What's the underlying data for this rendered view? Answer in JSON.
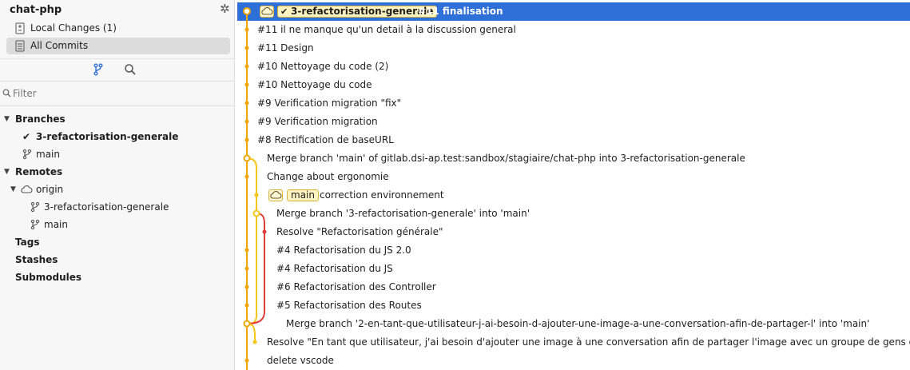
{
  "app": {
    "repo_name": "chat-php"
  },
  "views": {
    "local_changes": "Local Changes (1)",
    "all_commits": "All Commits"
  },
  "filter": {
    "placeholder": "Filter"
  },
  "tree": {
    "branches_header": "Branches",
    "branches": [
      "3-refactorisation-generale",
      "main"
    ],
    "remotes_header": "Remotes",
    "remote_name": "origin",
    "remote_branches": [
      "3-refactorisation-generale",
      "main"
    ],
    "tags_header": "Tags",
    "stashes_header": "Stashes",
    "submodules_header": "Submodules"
  },
  "colors": {
    "selection": "#2f6fd8",
    "graph_orange": "#f0a500",
    "graph_yellow": "#f5c518",
    "graph_red": "#e03c3c"
  },
  "commits": [
    {
      "message": "#11 finalisation",
      "branch_ref": "3-refactorisation-generale",
      "selected": true
    },
    {
      "message": "#11 il ne manque qu'un detail à la discussion general"
    },
    {
      "message": "#11 Design"
    },
    {
      "message": "#10 Nettoyage du code (2)"
    },
    {
      "message": "#10 Nettoyage du code"
    },
    {
      "message": "#9 Verification migration \"fix\""
    },
    {
      "message": "#9 Verification migration"
    },
    {
      "message": "#8 Rectification de baseURL"
    },
    {
      "message": "Merge branch 'main' of gitlab.dsi-ap.test:sandbox/stagiaire/chat-php into 3-refactorisation-generale"
    },
    {
      "message": "Change about ergonomie"
    },
    {
      "message": "correction environnement",
      "branch_ref": "main"
    },
    {
      "message": "Merge branch '3-refactorisation-generale' into 'main'"
    },
    {
      "message": "Resolve \"Refactorisation générale\""
    },
    {
      "message": "#4 Refactorisation du JS 2.0"
    },
    {
      "message": "#4 Refactorisation du JS"
    },
    {
      "message": "#6 Refactorisation des Controller"
    },
    {
      "message": "#5 Refactorisation des Routes"
    },
    {
      "message": "Merge branch '2-en-tant-que-utilisateur-j-ai-besoin-d-ajouter-une-image-a-une-conversation-afin-de-partager-l' into 'main'"
    },
    {
      "message": "Resolve \"En tant que utilisateur, j'ai besoin d'ajouter une image à une conversation afin de partager l'image avec un groupe de gens ou une personne\""
    },
    {
      "message": "delete vscode"
    }
  ]
}
